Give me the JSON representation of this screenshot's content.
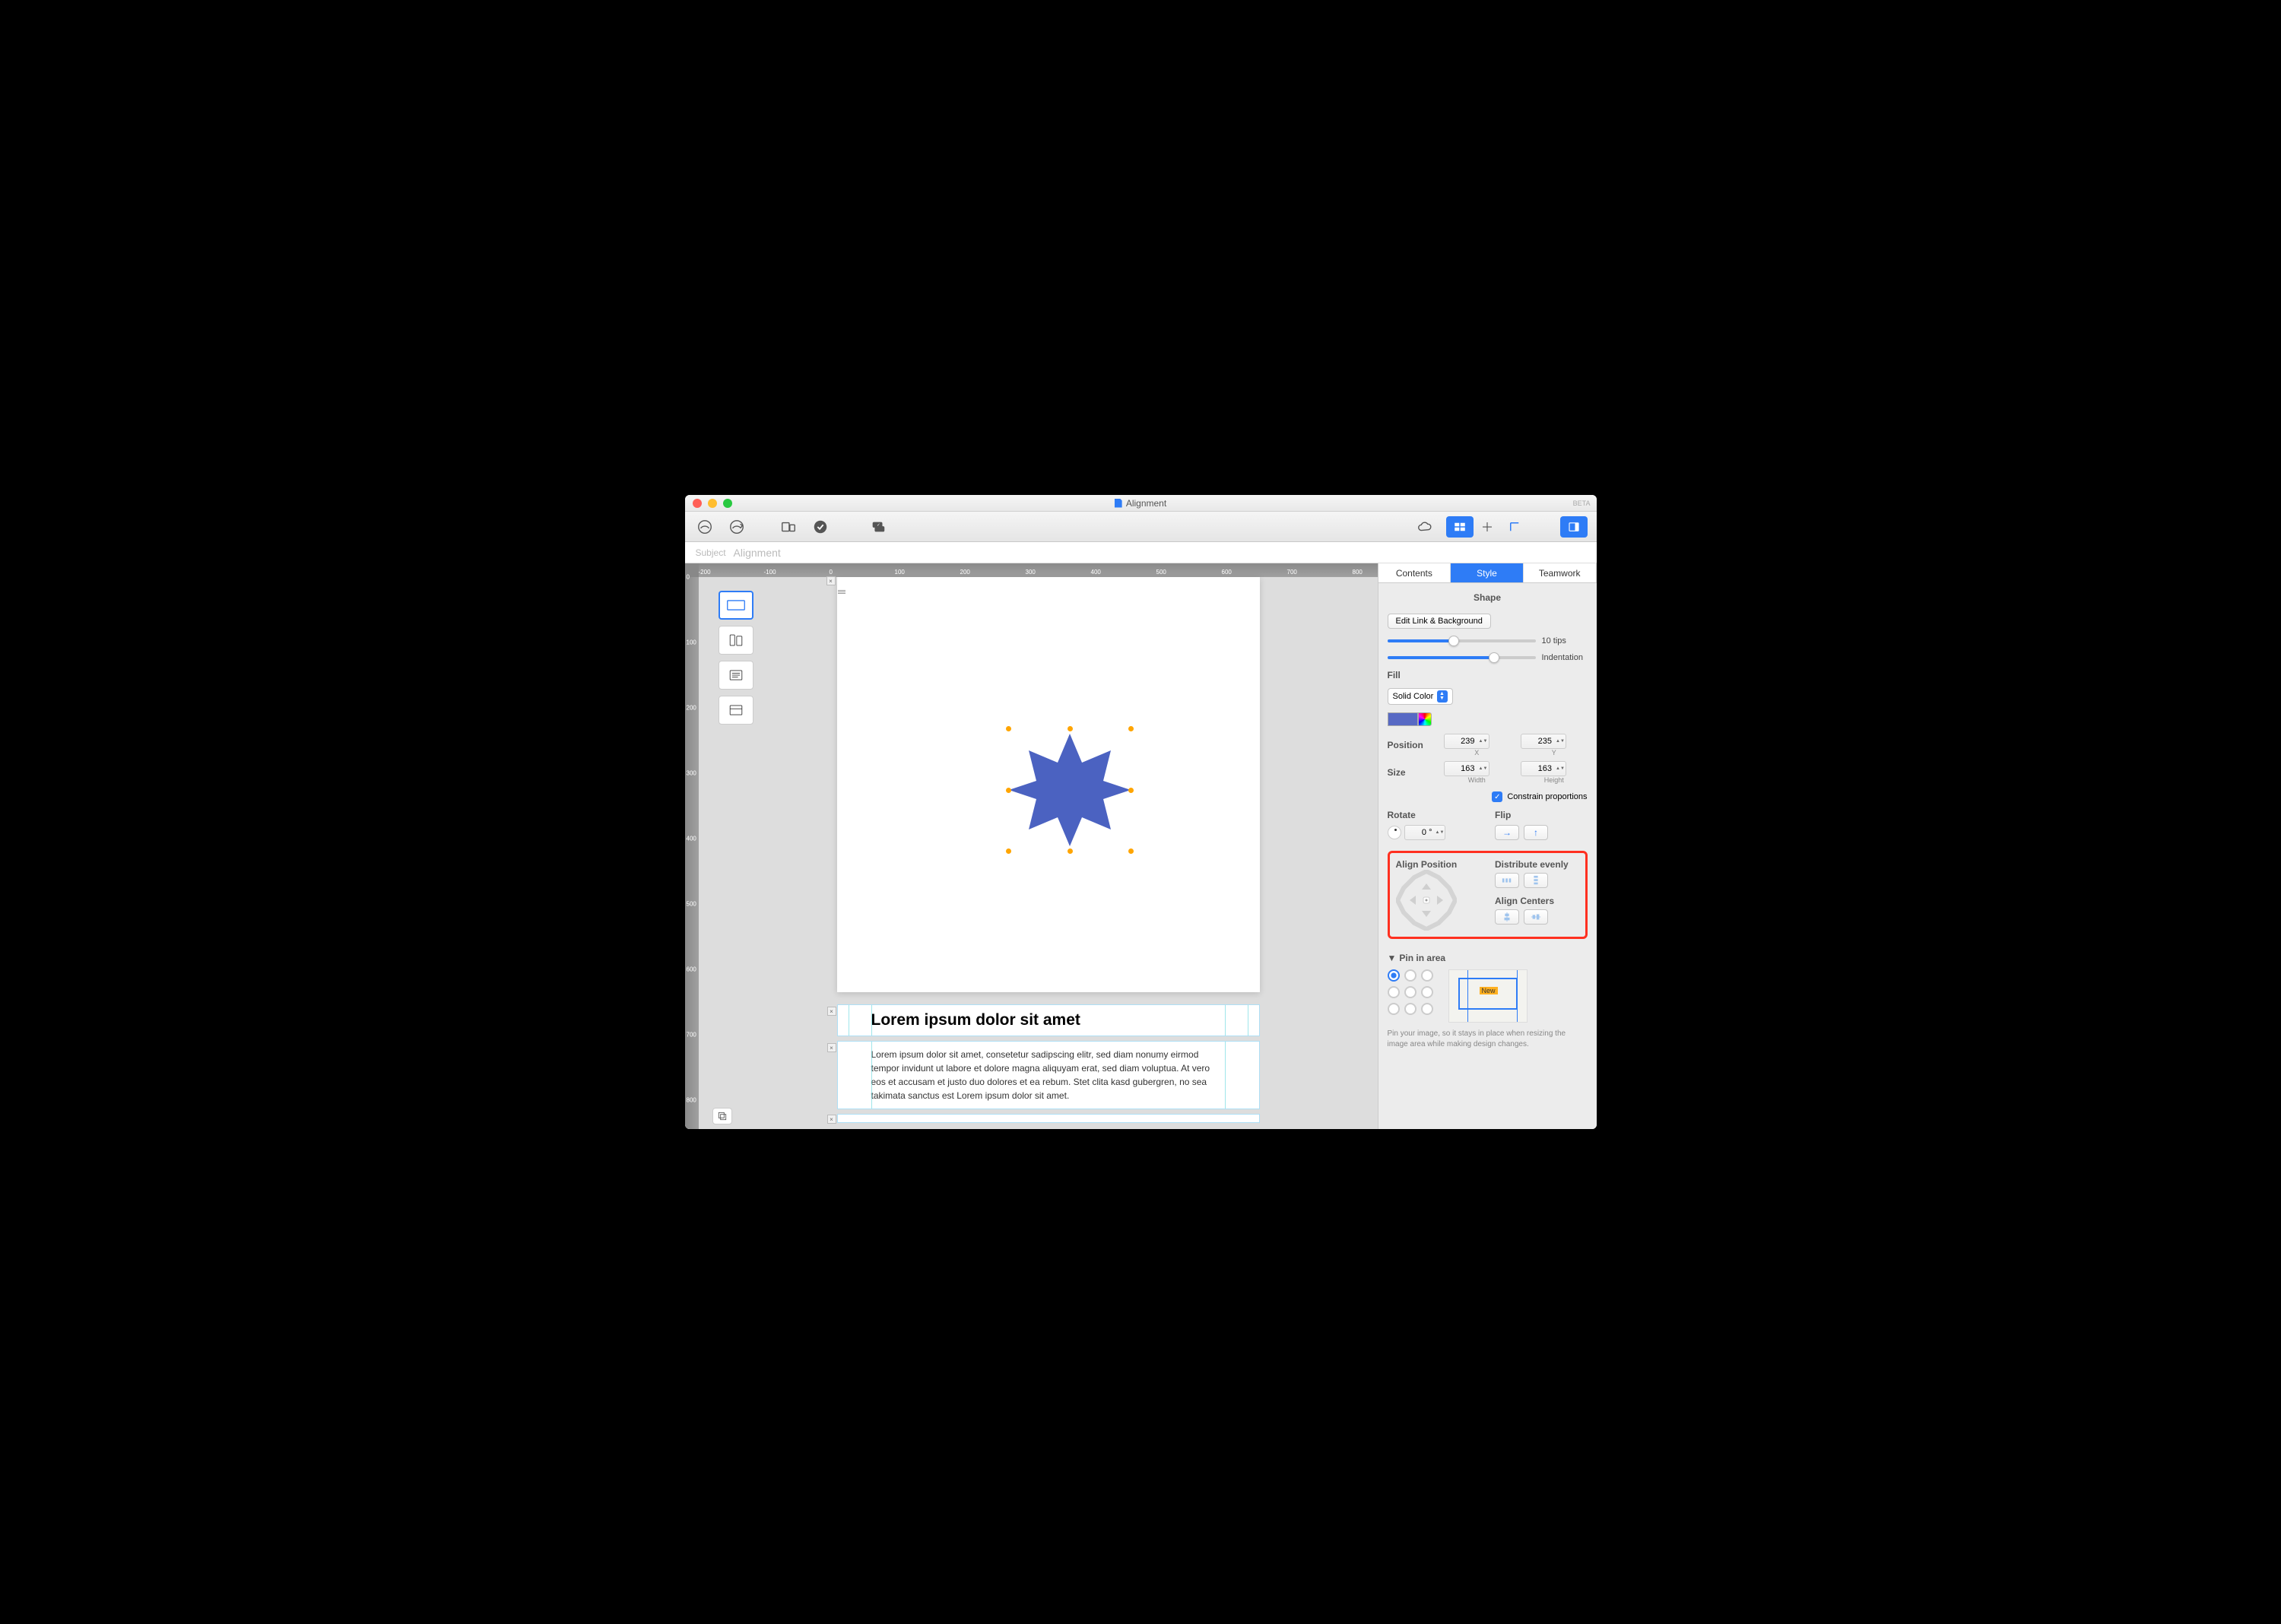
{
  "window": {
    "title": "Alignment",
    "beta": "BETA"
  },
  "subject": {
    "label": "Subject",
    "value": "Alignment"
  },
  "ruler_h": [
    "-200",
    "-100",
    "0",
    "100",
    "200",
    "300",
    "400",
    "500",
    "600",
    "700",
    "800"
  ],
  "ruler_v": [
    "0",
    "100",
    "200",
    "300",
    "400",
    "500",
    "600",
    "700",
    "800"
  ],
  "document": {
    "heading": "Lorem ipsum dolor sit amet",
    "body": "Lorem ipsum dolor sit amet, consetetur sadipscing elitr, sed diam nonumy eirmod tempor invidunt ut labore et dolore magna aliquyam erat, sed diam voluptua. At vero eos et accusam et justo duo dolores et ea rebum. Stet clita kasd gubergren, no sea takimata sanctus est Lorem ipsum dolor sit amet."
  },
  "inspector": {
    "tabs": {
      "contents": "Contents",
      "style": "Style",
      "teamwork": "Teamwork"
    },
    "shape_header": "Shape",
    "edit_link": "Edit Link & Background",
    "tips_label": "10 tips",
    "indent_label": "Indentation",
    "fill_label": "Fill",
    "fill_type": "Solid Color",
    "position_label": "Position",
    "size_label": "Size",
    "pos_x": "239",
    "pos_y": "235",
    "x_lbl": "X",
    "y_lbl": "Y",
    "size_w": "163",
    "size_h": "163",
    "w_lbl": "Width",
    "h_lbl": "Height",
    "constrain": "Constrain proportions",
    "rotate_label": "Rotate",
    "rotate_val": "0 °",
    "flip_label": "Flip",
    "align_pos": "Align Position",
    "distribute": "Distribute evenly",
    "align_centers": "Align Centers",
    "pin_label": "Pin in area",
    "pin_badge": "New",
    "pin_help": "Pin your image, so it stays in place when resizing the image area while making design changes."
  }
}
